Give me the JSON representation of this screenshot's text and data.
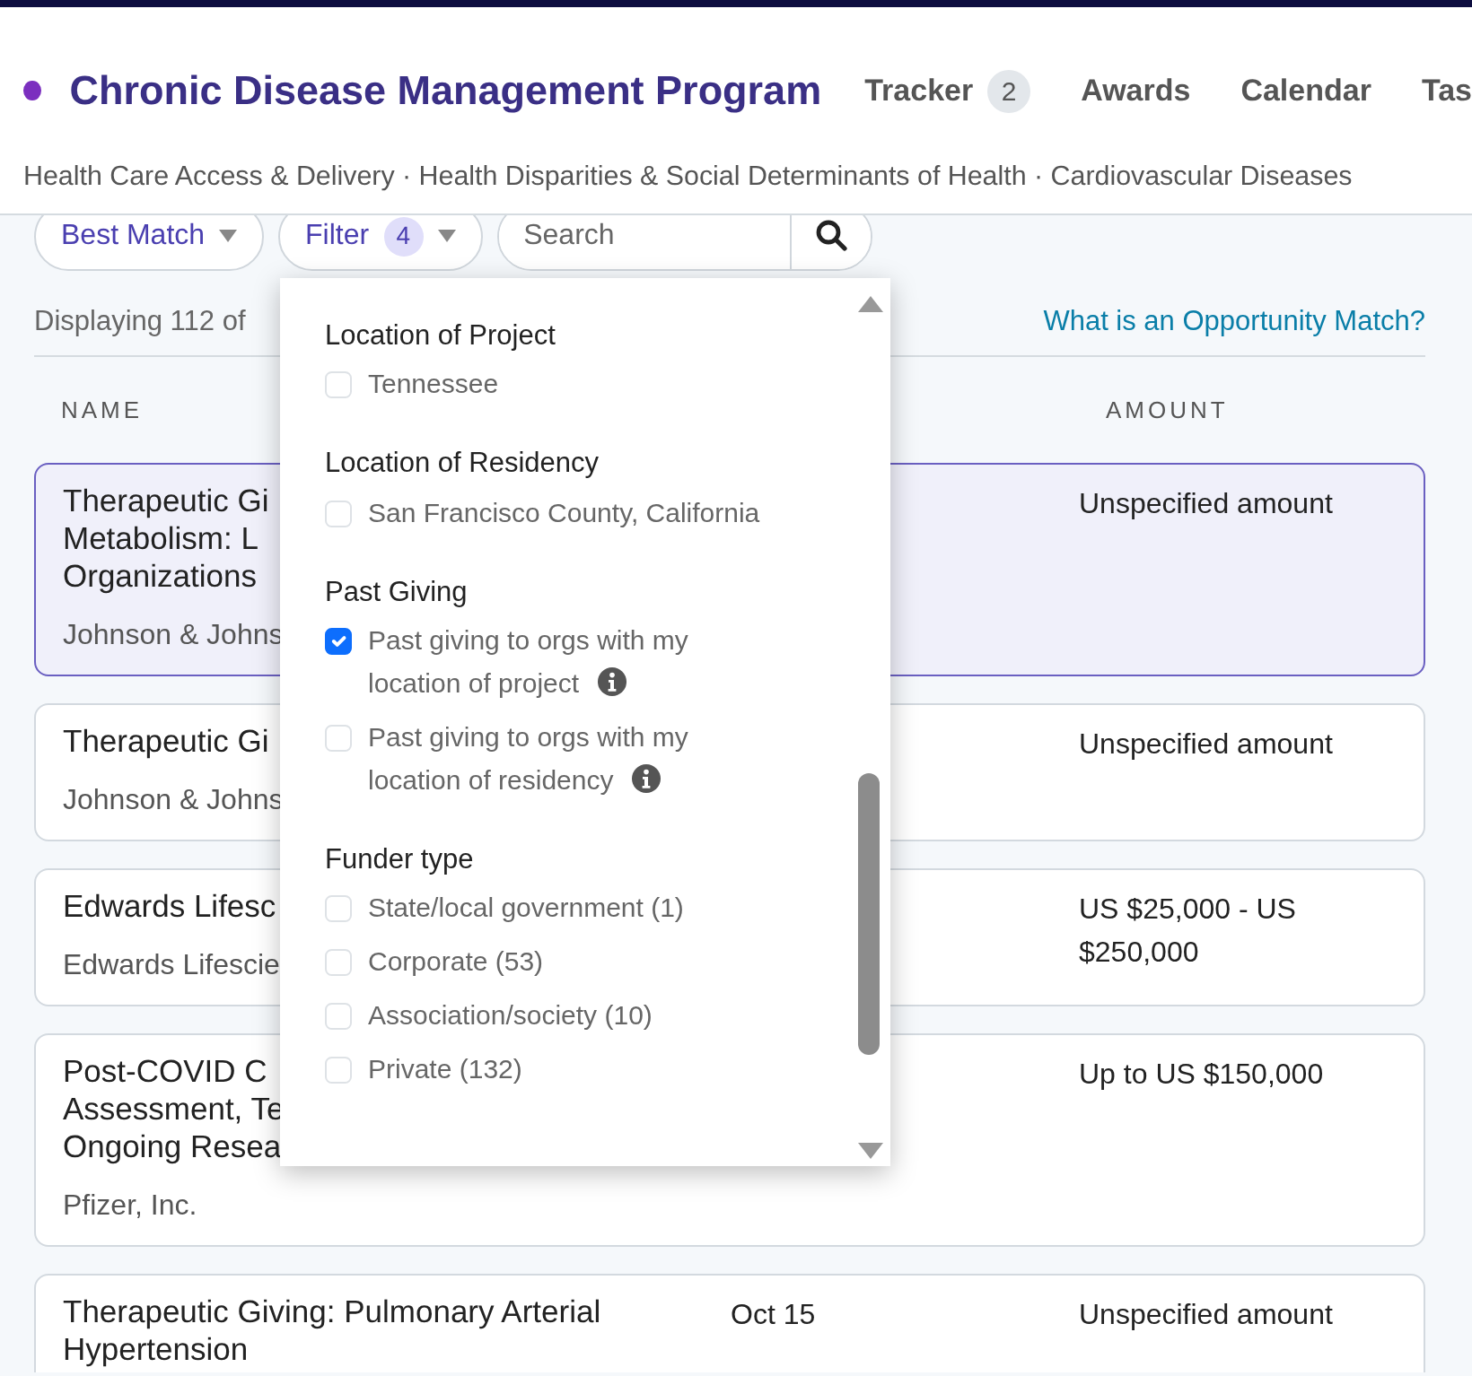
{
  "header": {
    "title": "Chronic Disease Management Program",
    "nav": [
      {
        "label": "Tracker",
        "badge": "2",
        "selected": false
      },
      {
        "label": "Awards",
        "selected": false
      },
      {
        "label": "Calendar",
        "selected": false
      },
      {
        "label": "Tas",
        "selected": false
      }
    ],
    "subtitle": "Health Care Access & Delivery · Health Disparities & Social Determinants of Health · Cardiovascular Diseases"
  },
  "toolbar": {
    "sort": "Best Match",
    "filter": {
      "label": "Filter",
      "count": "4"
    },
    "search": {
      "placeholder": "Search"
    }
  },
  "results": {
    "summary": "Displaying 112 of",
    "help_link": "What is an Opportunity Match?",
    "columns": [
      "NAME",
      "AMOUNT"
    ],
    "rows": [
      {
        "selected": true,
        "name_lines": [
          "Therapeutic Gi",
          "Metabolism: L",
          "Organizations"
        ],
        "funder": "Johnson & Johns",
        "amount": "Unspecified amount"
      },
      {
        "selected": false,
        "name_lines": [
          "Therapeutic Gi"
        ],
        "funder": "Johnson & Johns",
        "amount": "Unspecified amount"
      },
      {
        "selected": false,
        "name_lines": [
          "Edwards Lifesc"
        ],
        "funder": "Edwards Lifescie",
        "amount": "US $25,000 - US $250,000"
      },
      {
        "selected": false,
        "name_lines": [
          "Post-COVID C",
          "Assessment, Te",
          "Ongoing Resea"
        ],
        "funder": "Pfizer, Inc.",
        "amount": "Up to US $150,000"
      },
      {
        "selected": false,
        "name_lines": [
          "Therapeutic Giving: Pulmonary Arterial",
          "Hypertension"
        ],
        "date": "Oct 15",
        "amount": "Unspecified amount"
      }
    ]
  },
  "filter_menu": {
    "sections": [
      {
        "heading": "Location of Project",
        "options": [
          {
            "label": "Tennessee",
            "checked": false,
            "info": false
          }
        ]
      },
      {
        "heading": "Location of Residency",
        "options": [
          {
            "label": "San Francisco County, California",
            "checked": false,
            "info": false
          }
        ]
      },
      {
        "heading": "Past Giving",
        "options": [
          {
            "label": "Past giving to orgs with my location of project",
            "checked": true,
            "info": true
          },
          {
            "label": "Past giving to orgs with my location of residency",
            "checked": false,
            "info": true
          }
        ]
      },
      {
        "heading": "Funder type",
        "options": [
          {
            "label": "State/local government (1)",
            "checked": false,
            "info": false
          },
          {
            "label": "Corporate (53)",
            "checked": false,
            "info": false
          },
          {
            "label": "Association/society (10)",
            "checked": false,
            "info": false
          },
          {
            "label": "Private (132)",
            "checked": false,
            "info": false
          }
        ]
      }
    ]
  }
}
